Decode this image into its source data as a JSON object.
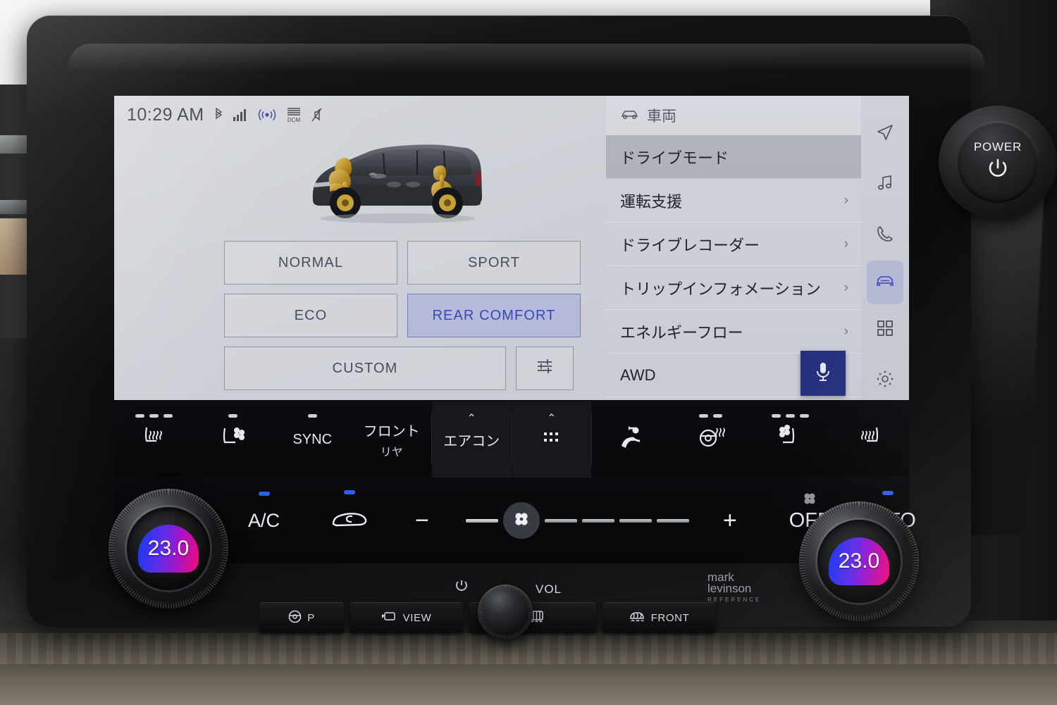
{
  "status_bar": {
    "clock": "10:29 AM",
    "icons": [
      {
        "name": "bluetooth-icon",
        "glyph": "✶"
      },
      {
        "name": "signal-bars-icon",
        "glyph": "▆"
      },
      {
        "name": "connectivity-icon",
        "glyph": "((•))"
      },
      {
        "name": "dcm-icon",
        "label": "DCM"
      },
      {
        "name": "mute-icon",
        "glyph": "¢"
      }
    ]
  },
  "drive_modes": {
    "buttons": [
      {
        "label": "NORMAL",
        "selected": false
      },
      {
        "label": "SPORT",
        "selected": false
      },
      {
        "label": "ECO",
        "selected": false
      },
      {
        "label": "REAR COMFORT",
        "selected": true
      },
      {
        "label": "CUSTOM",
        "selected": false
      }
    ],
    "adjust_icon": "sliders-icon",
    "selected_accent": "#3c47b4",
    "selected_fill": "#96a0de"
  },
  "menu": {
    "header": {
      "icon": "car-icon",
      "title": "車両"
    },
    "items": [
      {
        "label": "ドライブモード",
        "chevron": "",
        "active": true
      },
      {
        "label": "運転支援",
        "chevron": "›",
        "active": false
      },
      {
        "label": "ドライブレコーダー",
        "chevron": "›",
        "active": false
      },
      {
        "label": "トリップインフォメーション",
        "chevron": "›",
        "active": false
      },
      {
        "label": "エネルギーフロー",
        "chevron": "›",
        "active": false
      },
      {
        "label": "AWD",
        "chevron": "",
        "active": false
      }
    ]
  },
  "sidebar": {
    "items": [
      {
        "name": "navigation-icon",
        "active": false
      },
      {
        "name": "media-icon",
        "active": false
      },
      {
        "name": "phone-icon",
        "active": false
      },
      {
        "name": "vehicle-icon",
        "active": true
      },
      {
        "name": "apps-icon",
        "active": false
      },
      {
        "name": "settings-icon",
        "active": false
      }
    ],
    "active_color": "#4a55c4"
  },
  "voice_button": {
    "name": "microphone-button",
    "color": "#27317e"
  },
  "climate_bar": {
    "items": [
      {
        "name": "driver-seat-heater",
        "type": "icon",
        "indicators": 3,
        "indicator_color": "#cdd0d6"
      },
      {
        "name": "driver-seat-ventilation",
        "type": "icon",
        "indicators": 1,
        "indicator_color": "#cdd0d6"
      },
      {
        "name": "sync-button",
        "type": "text",
        "label": "SYNC",
        "indicators": 1,
        "indicator_color": "#cdd0d6"
      },
      {
        "name": "front-rear-button",
        "type": "text",
        "label": "フロント",
        "sub": "リヤ",
        "indicators": 0
      },
      {
        "name": "aircon-panel-button",
        "type": "text",
        "label": "エアコン",
        "chevron": "⌃",
        "indicators": 0
      },
      {
        "name": "more-options-button",
        "type": "icon",
        "chevron": "⌃",
        "indicators": 0
      },
      {
        "name": "seat-position-button",
        "type": "icon",
        "indicators": 0
      },
      {
        "name": "steering-wheel-heater",
        "type": "icon",
        "indicators": 2,
        "indicator_color": "#cdd0d6"
      },
      {
        "name": "passenger-seat-ventilation",
        "type": "icon",
        "indicators": 3,
        "indicator_color": "#cdd0d6"
      },
      {
        "name": "passenger-seat-heater",
        "type": "icon",
        "indicators": 0
      }
    ]
  },
  "fan_row": {
    "ac_button": {
      "label": "A/C",
      "active": true
    },
    "recirculation_button": {
      "name": "recirculation-icon",
      "active": true
    },
    "minus_button": "−",
    "plus_button": "+",
    "fan_level": 3,
    "fan_segments_total": 5,
    "off_button": {
      "label": "OFF",
      "active": false
    },
    "auto_button": {
      "label": "AUTO",
      "active": true
    },
    "indicator_color": "#2f5fe8"
  },
  "temperature": {
    "left_knob": {
      "name": "driver-temp-knob",
      "value": "23.0"
    },
    "right_knob": {
      "name": "passenger-temp-knob",
      "value": "23.0"
    }
  },
  "hard_buttons": [
    {
      "name": "park-assist-button",
      "label": "P",
      "icon": "steering-wheel-icon"
    },
    {
      "name": "camera-view-button",
      "label": "VIEW",
      "icon": "camera-view-icon"
    },
    {
      "name": "rear-defogger-button",
      "label": "",
      "icon": "rear-defogger-icon"
    },
    {
      "name": "front-defroster-button",
      "label": "FRONT",
      "icon": "front-defroster-icon"
    }
  ],
  "volume": {
    "power_icon": "power-icon",
    "label": "VOL"
  },
  "audio_brand": {
    "line1": "mark",
    "line2": "levinson",
    "line3": "REFERENCE"
  },
  "start_button": {
    "label": "POWER",
    "icon": "power-icon"
  }
}
